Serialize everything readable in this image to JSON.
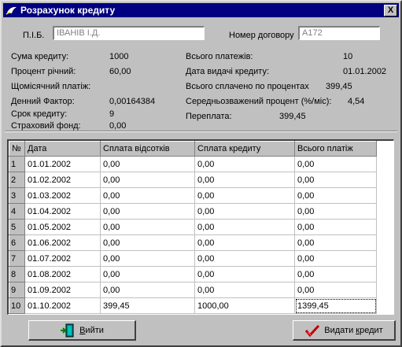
{
  "window": {
    "title": "Розрахунок кредиту",
    "close_label": "X"
  },
  "form": {
    "pib_label": "П.І.Б.",
    "pib_value": "ІВАНІВ І.Д.",
    "contract_label": "Номер договору",
    "contract_value": "А172",
    "left": [
      {
        "label": "Сума кредиту:",
        "value": "1000"
      },
      {
        "label": "Процент річний:",
        "value": "60,00"
      },
      {
        "label": "Щомісячний платіж:",
        "value": ""
      },
      {
        "label": "Денний Фактор:",
        "value": "0,00164384"
      },
      {
        "label": "Срок кредиту:",
        "value": "9"
      },
      {
        "label": "Страховий фонд:",
        "value": "0,00"
      }
    ],
    "right": [
      {
        "label": "Всього платежів:",
        "value": "10"
      },
      {
        "label": "Дата видачі кредиту:",
        "value": "01.01.2002"
      },
      {
        "label": "Всього сплачено по процентах",
        "value": "399,45"
      },
      {
        "label": "Середньозважений процент (%/міс):",
        "value": "4,54"
      },
      {
        "label": "Переплата:",
        "value": "399,45"
      }
    ]
  },
  "grid": {
    "headers": [
      "№",
      "Дата",
      "Сплата відсотків",
      "Сплата кредиту",
      "Всього платіж"
    ],
    "rows": [
      [
        "1",
        "01.01.2002",
        "0,00",
        "0,00",
        "0,00"
      ],
      [
        "2",
        "01.02.2002",
        "0,00",
        "0,00",
        "0,00"
      ],
      [
        "3",
        "01.03.2002",
        "0,00",
        "0,00",
        "0,00"
      ],
      [
        "4",
        "01.04.2002",
        "0,00",
        "0,00",
        "0,00"
      ],
      [
        "5",
        "01.05.2002",
        "0,00",
        "0,00",
        "0,00"
      ],
      [
        "6",
        "01.06.2002",
        "0,00",
        "0,00",
        "0,00"
      ],
      [
        "7",
        "01.07.2002",
        "0,00",
        "0,00",
        "0,00"
      ],
      [
        "8",
        "01.08.2002",
        "0,00",
        "0,00",
        "0,00"
      ],
      [
        "9",
        "01.09.2002",
        "0,00",
        "0,00",
        "0,00"
      ],
      [
        "10",
        "01.10.2002",
        "399,45",
        "1000,00",
        "1399,45"
      ]
    ]
  },
  "buttons": {
    "exit_label_u": "В",
    "exit_label_rest": "ийти",
    "issue_label_pre": "Видати ",
    "issue_label_u": "к",
    "issue_label_rest": "редит",
    "exit_icon": "exit-door-icon",
    "issue_icon": "checkmark-icon"
  }
}
